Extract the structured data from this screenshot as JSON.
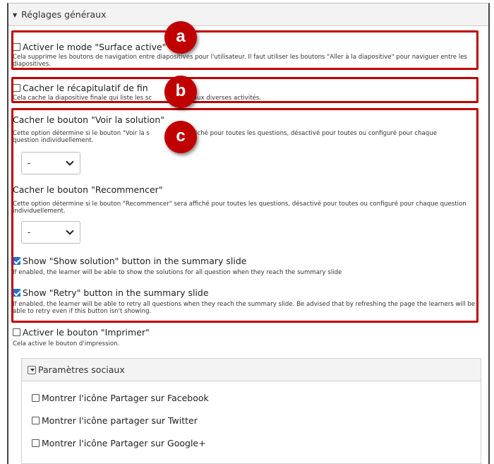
{
  "header": {
    "title": "Réglages généraux"
  },
  "options": {
    "surface": {
      "label": "Activer le mode \"Surface active\"",
      "desc": "Cela supprime les boutons de navigation entre diapositives pour l'utilisateur. Il faut utiliser les boutons \"Aller à la diapositive\" pour naviguer entre les diapositives.",
      "checked": false
    },
    "summary": {
      "label": "Cacher le récapitulatif de fin",
      "desc_part1": "Cela cache la diapositive finale qui liste les sc",
      "desc_part2": "us aux diverses activités.",
      "checked": false
    },
    "hide_solution": {
      "label": "Cacher le bouton \"Voir la solution\"",
      "desc_part1": "Cette option détermine si le bouton \"Voir la s",
      "desc_part2": "a affiché pour toutes les questions, désactivé pour toutes ou configuré pour chaque",
      "desc_line2": "question individuellement.",
      "select_value": "-"
    },
    "hide_retry": {
      "label": "Cacher le bouton \"Recommencer\"",
      "desc": "Cette option détermine si le bouton \"Recommencer\" sera affiché pour toutes les questions, désactivé pour toutes ou configuré pour chaque question individuellement.",
      "select_value": "-"
    },
    "show_solution_summary": {
      "label": "Show \"Show solution\" button in the summary slide",
      "desc": "If enabled, the learner will be able to show the solutions for all question when they reach the summary slide",
      "checked": true
    },
    "show_retry_summary": {
      "label": "Show \"Retry\" button in the summary slide",
      "desc": "If enabled, the learner will be able to retry all questions when they reach the summary slide. Be advised that by refreshing the page the learners will be able to retry even if this button isn't showing.",
      "checked": true
    },
    "print": {
      "label": "Activer le bouton \"Imprimer\"",
      "desc": "Cela active le bouton d'impression.",
      "checked": false
    }
  },
  "badges": {
    "a": "a",
    "b": "b",
    "c": "c"
  },
  "social": {
    "title": "Paramètres sociaux",
    "items": [
      {
        "label": "Montrer l'icône Partager sur Facebook",
        "checked": false
      },
      {
        "label": "Montrer l'icône partager sur Twitter",
        "checked": false
      },
      {
        "label": "Montrer l'icône Partager sur Google+",
        "checked": false
      }
    ]
  },
  "colors": {
    "highlight": "#c00000",
    "checkbox_checked": "#1e6fd9"
  }
}
